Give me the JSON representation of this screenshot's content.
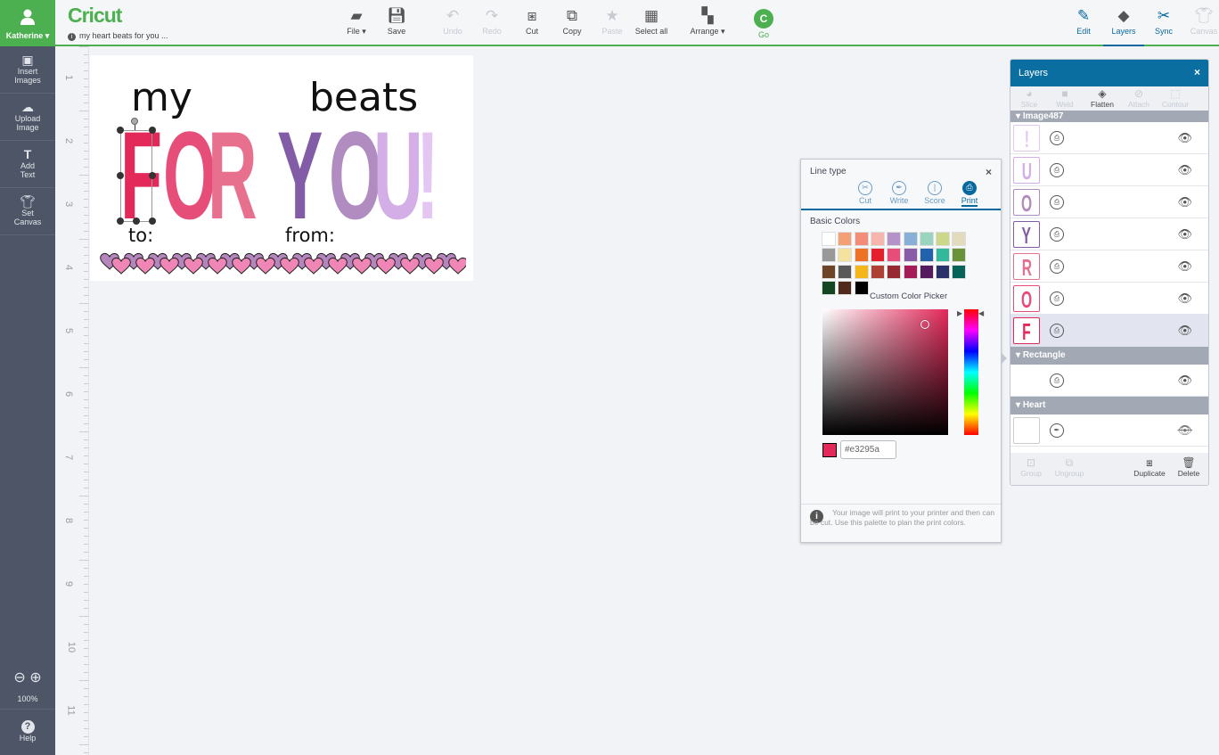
{
  "user": {
    "name": "Katherine"
  },
  "app": {
    "logo": "Cricut",
    "project_title": "my heart beats for you ..."
  },
  "toolbar": {
    "items": [
      {
        "label": "File",
        "icon": "folder-icon"
      },
      {
        "label": "Save",
        "icon": "save-icon"
      },
      {
        "label": "Undo",
        "icon": "undo-icon",
        "disabled": true
      },
      {
        "label": "Redo",
        "icon": "redo-icon",
        "disabled": true
      },
      {
        "label": "Cut",
        "icon": "cut-icon"
      },
      {
        "label": "Copy",
        "icon": "copy-icon"
      },
      {
        "label": "Paste",
        "icon": "paste-icon",
        "disabled": true
      },
      {
        "label": "Select all",
        "icon": "select-all-icon"
      },
      {
        "label": "Arrange",
        "icon": "arrange-icon"
      },
      {
        "label": "Go",
        "icon": "go-icon"
      }
    ],
    "right": [
      {
        "label": "Edit"
      },
      {
        "label": "Layers",
        "selected": true
      },
      {
        "label": "Sync"
      },
      {
        "label": "Canvas",
        "disabled": true
      }
    ]
  },
  "sidebar": {
    "items": [
      {
        "label": "Insert Images"
      },
      {
        "label": "Upload Image"
      },
      {
        "label": "Add Text"
      },
      {
        "label": "Set Canvas"
      }
    ],
    "zoom": "100%",
    "help": "Help"
  },
  "ruler": [
    "1",
    "2",
    "3",
    "4",
    "5",
    "6",
    "7",
    "8",
    "9",
    "10",
    "11"
  ],
  "canvas": {
    "words": {
      "my": "my",
      "beats": "beats",
      "to": "to:",
      "from": "from:"
    },
    "letters": [
      {
        "ch": "F",
        "color": "#e3295a"
      },
      {
        "ch": "O",
        "color": "#e64d78"
      },
      {
        "ch": "R",
        "color": "#e8708f"
      },
      {
        "ch": "Y",
        "color": "#825ca6"
      },
      {
        "ch": "O",
        "color": "#b08cc0"
      },
      {
        "ch": "U",
        "color": "#d4aee6"
      },
      {
        "ch": "!",
        "color": "#e3c6f2"
      }
    ]
  },
  "linetype": {
    "title": "Line type",
    "options": [
      "Cut",
      "Write",
      "Score",
      "Print"
    ],
    "selected": "Print",
    "basic_colors_label": "Basic Colors",
    "colors": [
      "#ffffff",
      "#f4a077",
      "#f48d77",
      "#f7b6ad",
      "#b393c8",
      "#88b0d6",
      "#98d4be",
      "#cbd889",
      "#e3dbbd",
      "#999999",
      "#f5e2a0",
      "#ee7226",
      "#e4202e",
      "#e84d7a",
      "#8a5ca8",
      "#2262ad",
      "#32b89a",
      "#6a9239",
      "#6d4427",
      "#595959",
      "#f3b71b",
      "#ae4135",
      "#962a30",
      "#a61a57",
      "#541b5f",
      "#2a3069",
      "#05635a",
      "#134721",
      "#4f2a1d",
      "#000000"
    ],
    "custom_label": "Custom Color Picker",
    "hex": "#e3295a",
    "info": "Your image will print to your printer and then can be cut. Use this palette to plan the print colors."
  },
  "layers": {
    "title": "Layers",
    "tools": [
      "Slice",
      "Weld",
      "Flatten",
      "Attach",
      "Contour"
    ],
    "group1": "Image487",
    "rows": [
      {
        "ch": "!",
        "color": "#e3c6f2"
      },
      {
        "ch": "U",
        "color": "#d4aee6"
      },
      {
        "ch": "O",
        "color": "#b08cc0"
      },
      {
        "ch": "Y",
        "color": "#825ca6"
      },
      {
        "ch": "R",
        "color": "#e8708f"
      },
      {
        "ch": "O",
        "color": "#e64d78"
      },
      {
        "ch": "F",
        "color": "#e3295a"
      }
    ],
    "group2": "Rectangle",
    "group3": "Heart",
    "footer": [
      "Group",
      "Ungroup",
      "Duplicate",
      "Delete"
    ]
  }
}
